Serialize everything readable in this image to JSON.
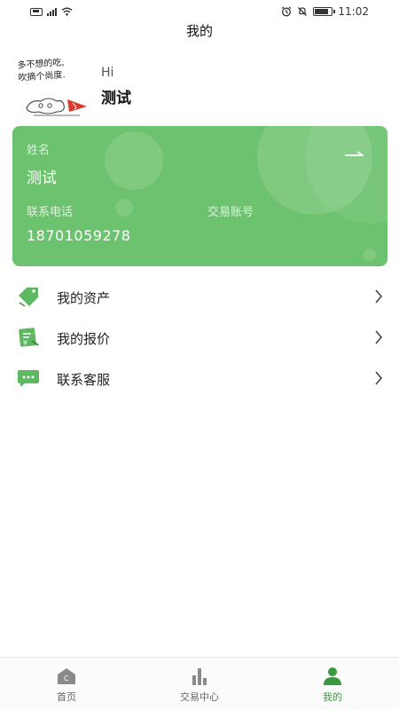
{
  "status_bar": {
    "time": "11:02"
  },
  "header": {
    "title": "我的"
  },
  "profile": {
    "greeting": "Hi",
    "display_name": "测试",
    "avatar_caption_line1": "多不想的吃,",
    "avatar_caption_line2": "吹摘个尚度."
  },
  "card": {
    "name_label": "姓名",
    "name_value": "测试",
    "phone_label": "联系电话",
    "phone_value": "18701059278",
    "account_label": "交易账号",
    "account_value": "",
    "bg_color": "#6cc26f"
  },
  "menu": [
    {
      "label": "我的资产",
      "icon": "tag-icon"
    },
    {
      "label": "我的报价",
      "icon": "quote-icon"
    },
    {
      "label": "联系客服",
      "icon": "chat-icon"
    }
  ],
  "tabbar": {
    "tabs": [
      {
        "label": "首页",
        "icon": "home-icon"
      },
      {
        "label": "交易中心",
        "icon": "bar-chart-icon"
      },
      {
        "label": "我的",
        "icon": "user-icon"
      }
    ],
    "active_index": 2,
    "active_color": "#3a9a41"
  }
}
